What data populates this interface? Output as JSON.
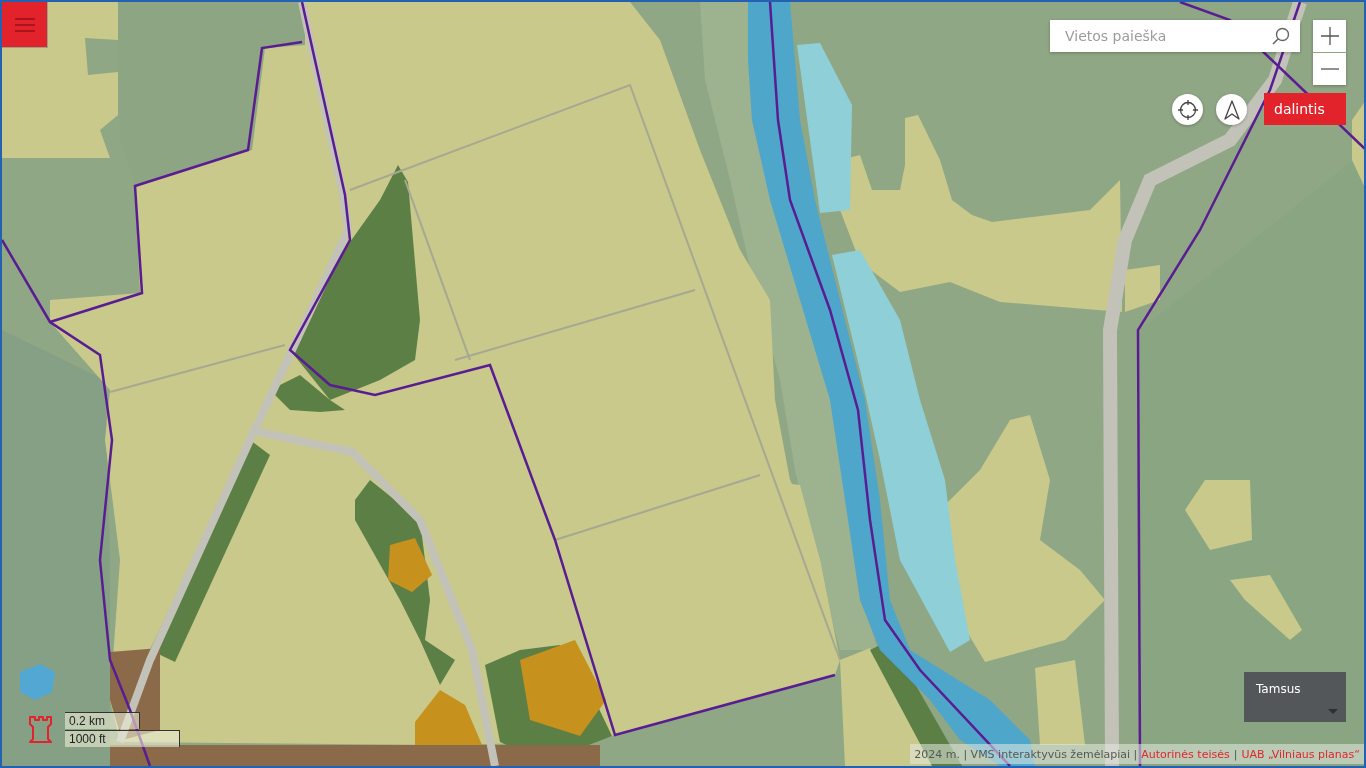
{
  "search": {
    "placeholder": "Vietos paieška"
  },
  "share_button": {
    "label": "dalintis"
  },
  "scale_bar": {
    "metric": "0.2 km",
    "imperial": "1000 ft"
  },
  "basemap_select": {
    "value": "Tamsus"
  },
  "attribution": [
    {
      "kind": "text",
      "text": "2024 m. | VMS interaktyvūs žemėlapiai |"
    },
    {
      "kind": "link",
      "text": "Autorinės teisės"
    },
    {
      "kind": "text",
      "text": "|"
    },
    {
      "kind": "link",
      "text": "UAB „Vilniaus planas“"
    }
  ]
}
